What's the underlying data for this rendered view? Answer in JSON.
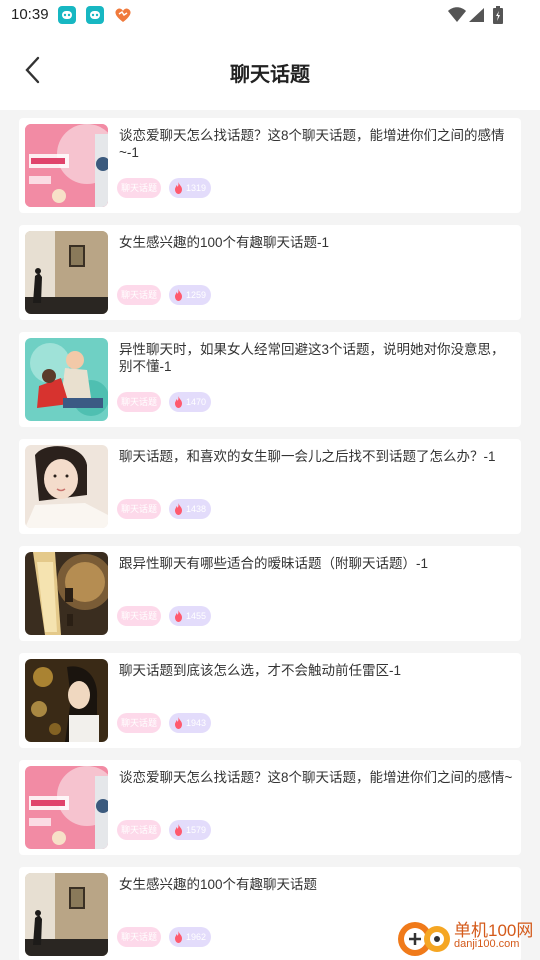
{
  "status_bar": {
    "time": "10:39"
  },
  "header": {
    "title": "聊天话题"
  },
  "items": [
    {
      "title": "谈恋爱聊天怎么找话题？这8个聊天话题，能增进你们之间的感情~-1",
      "tag": "聊天话题",
      "count": "1319",
      "thumb": "couple-pink"
    },
    {
      "title": "女生感兴趣的100个有趣聊天话题-1",
      "tag": "聊天话题",
      "count": "1259",
      "thumb": "street-wall"
    },
    {
      "title": "异性聊天时，如果女人经常回避这3个话题，说明她对你没意思，别不懂-1",
      "tag": "聊天话题",
      "count": "1470",
      "thumb": "couple-illustration"
    },
    {
      "title": "聊天话题，和喜欢的女生聊一会儿之后找不到话题了怎么办？-1",
      "tag": "聊天话题",
      "count": "1438",
      "thumb": "woman-portrait"
    },
    {
      "title": "跟异性聊天有哪些适合的暧昧话题（附聊天话题）-1",
      "tag": "聊天话题",
      "count": "1455",
      "thumb": "champagne-clock"
    },
    {
      "title": "聊天话题到底该怎么选，才不会触动前任雷区-1",
      "tag": "聊天话题",
      "count": "1943",
      "thumb": "woman-bokeh"
    },
    {
      "title": "谈恋爱聊天怎么找话题？这8个聊天话题，能增进你们之间的感情~",
      "tag": "聊天话题",
      "count": "1579",
      "thumb": "couple-pink"
    },
    {
      "title": "女生感兴趣的100个有趣聊天话题",
      "tag": "聊天话题",
      "count": "1962",
      "thumb": "street-wall"
    }
  ],
  "watermark": {
    "name": "单机100网",
    "url": "danji100.com"
  },
  "colors": {
    "tag_bg": "#fdd9ea",
    "hot_bg": "#e3dcfb",
    "fire": "#ff5a6e"
  }
}
